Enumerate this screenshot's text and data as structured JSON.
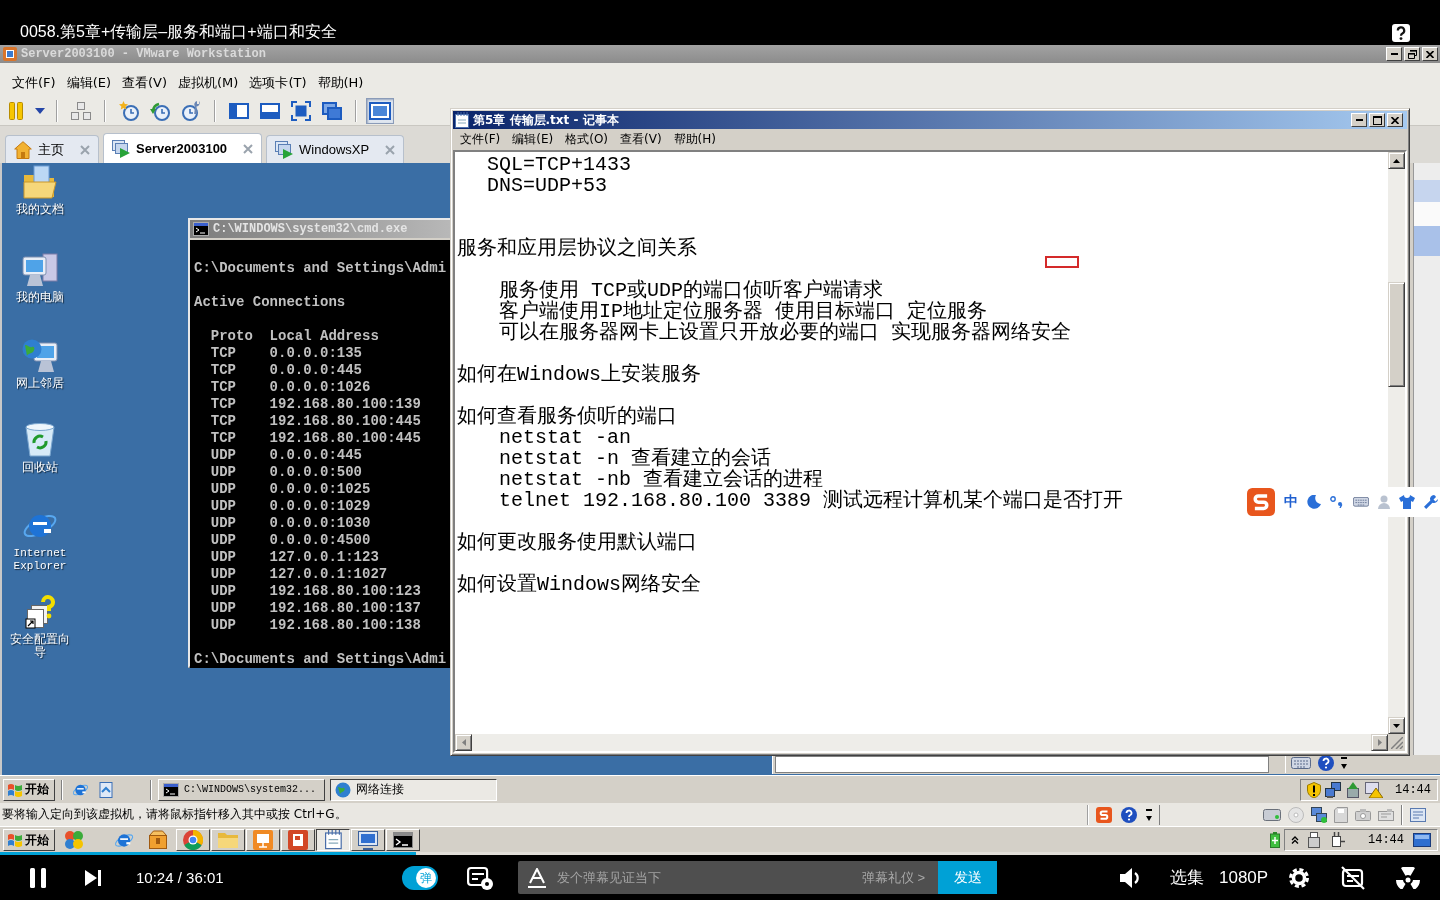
{
  "video": {
    "title": "0058.第5章+传输层–服务和端口+端口和安全"
  },
  "vmware": {
    "title": "Server2003100 - VMware Workstation",
    "menu": [
      "文件(F)",
      "编辑(E)",
      "查看(V)",
      "虚拟机(M)",
      "选项卡(T)",
      "帮助(H)"
    ],
    "toolbar": [
      [
        {
          "kind": "pause",
          "on": false
        },
        {
          "kind": "dropdown",
          "on": false
        }
      ],
      [
        {
          "kind": "team",
          "on": false
        }
      ],
      [
        {
          "kind": "snapshot",
          "on": false
        },
        {
          "kind": "revert",
          "on": false
        },
        {
          "kind": "manager",
          "on": false
        }
      ],
      [
        {
          "kind": "sidebar",
          "on": false
        },
        {
          "kind": "thumbnails",
          "on": false
        },
        {
          "kind": "fullscreen",
          "on": false
        },
        {
          "kind": "unity",
          "on": false
        }
      ],
      [
        {
          "kind": "console",
          "on": true
        }
      ]
    ],
    "tabs": [
      {
        "label": "主页",
        "kind": "home",
        "selected": false
      },
      {
        "label": "Server2003100",
        "kind": "vm",
        "selected": true
      },
      {
        "label": "WindowsXP",
        "kind": "vm",
        "selected": false
      }
    ],
    "status": "要将输入定向到该虚拟机，请将鼠标指针移入其中或按 Ctrl+G。"
  },
  "guest": {
    "desktop_icons": [
      {
        "label": "我的文档",
        "kind": "documents"
      },
      {
        "label": "我的电脑",
        "kind": "computer"
      },
      {
        "label": "网上邻居",
        "kind": "network"
      },
      {
        "label": "回收站",
        "kind": "recycle"
      },
      {
        "label": "Internet Explorer",
        "kind": "browser"
      },
      {
        "label": "安全配置向导",
        "kind": "wizard"
      }
    ],
    "cmd": {
      "title": "C:\\WINDOWS\\system32\\cmd.exe",
      "prompt": "C:\\Documents and Settings\\Admi",
      "heading": "Active Connections",
      "columns": [
        "Proto",
        "Local Address"
      ],
      "rows": [
        [
          "TCP",
          "0.0.0.0:135"
        ],
        [
          "TCP",
          "0.0.0.0:445"
        ],
        [
          "TCP",
          "0.0.0.0:1026"
        ],
        [
          "TCP",
          "192.168.80.100:139"
        ],
        [
          "TCP",
          "192.168.80.100:445"
        ],
        [
          "TCP",
          "192.168.80.100:445"
        ],
        [
          "UDP",
          "0.0.0.0:445"
        ],
        [
          "UDP",
          "0.0.0.0:500"
        ],
        [
          "UDP",
          "0.0.0.0:1025"
        ],
        [
          "UDP",
          "0.0.0.0:1029"
        ],
        [
          "UDP",
          "0.0.0.0:1030"
        ],
        [
          "UDP",
          "0.0.0.0:4500"
        ],
        [
          "UDP",
          "127.0.0.1:123"
        ],
        [
          "UDP",
          "127.0.0.1:1027"
        ],
        [
          "UDP",
          "192.168.80.100:123"
        ],
        [
          "UDP",
          "192.168.80.100:137"
        ],
        [
          "UDP",
          "192.168.80.100:138"
        ]
      ],
      "final_prompt": "C:\\Documents and Settings\\Admi"
    },
    "taskbar": {
      "start": "开始",
      "tasks": [
        {
          "label": "C:\\WINDOWS\\system32...",
          "kind": "terminal",
          "selected": false
        },
        {
          "label": "网络连接",
          "kind": "network",
          "selected": true
        }
      ],
      "clock": "14:44"
    }
  },
  "notepad": {
    "title": "第5章 传输层.txt - 记事本",
    "menu": [
      "文件(F)",
      "编辑(E)",
      "格式(O)",
      "查看(V)",
      "帮助(H)"
    ],
    "paragraphs": [
      {
        "children": [
          "SQL=TCP+1433",
          "DNS=UDP+53"
        ]
      },
      {
        "text": "服务和应用层协议之间关系"
      },
      {
        "children": [
          "服务使用 TCP或UDP的端口侦听客户端请求",
          "客户端使用IP地址定位服务器 使用目标端口 定位服务",
          "可以在服务器网卡上设置只开放必要的端口 实现服务器网络安全"
        ]
      },
      {
        "text": "如何在Windows上安装服务"
      },
      {
        "text": "如何查看服务侦听的端口",
        "children": [
          "netstat -an",
          "netstat -n 查看建立的会话",
          "netstat -nb 查看建立会话的进程",
          "telnet 192.168.80.100 3389 测试远程计算机某个端口是否打开"
        ]
      },
      {
        "text": "如何更改服务使用默认端口"
      },
      {
        "text": "如何设置Windows网络安全"
      }
    ]
  },
  "ime": {
    "mode": "中"
  },
  "host_taskbar": {
    "start": "开始",
    "quick_launch": [
      {
        "kind": "suite"
      },
      {
        "kind": "browser"
      },
      {
        "kind": "tool"
      }
    ],
    "tasks": [
      {
        "kind": "wheel",
        "selected": false
      },
      {
        "kind": "folder",
        "selected": false
      },
      {
        "kind": "media",
        "selected": false
      },
      {
        "kind": "slides",
        "selected": false
      },
      {
        "kind": "notepad",
        "selected": true
      },
      {
        "kind": "vm",
        "selected": false
      },
      {
        "kind": "terminal",
        "selected": false
      }
    ],
    "clock": "14:44"
  },
  "player": {
    "progress": {
      "level": 0.289
    },
    "time": "10:24 / 36:01",
    "danmaku": {
      "label": "弹",
      "on": true
    },
    "comment": {
      "placeholder": "发个弹幕见证当下"
    },
    "etiquette": "弹幕礼仪 >",
    "send": "发送",
    "episodes": "选集",
    "quality": "1080P"
  }
}
